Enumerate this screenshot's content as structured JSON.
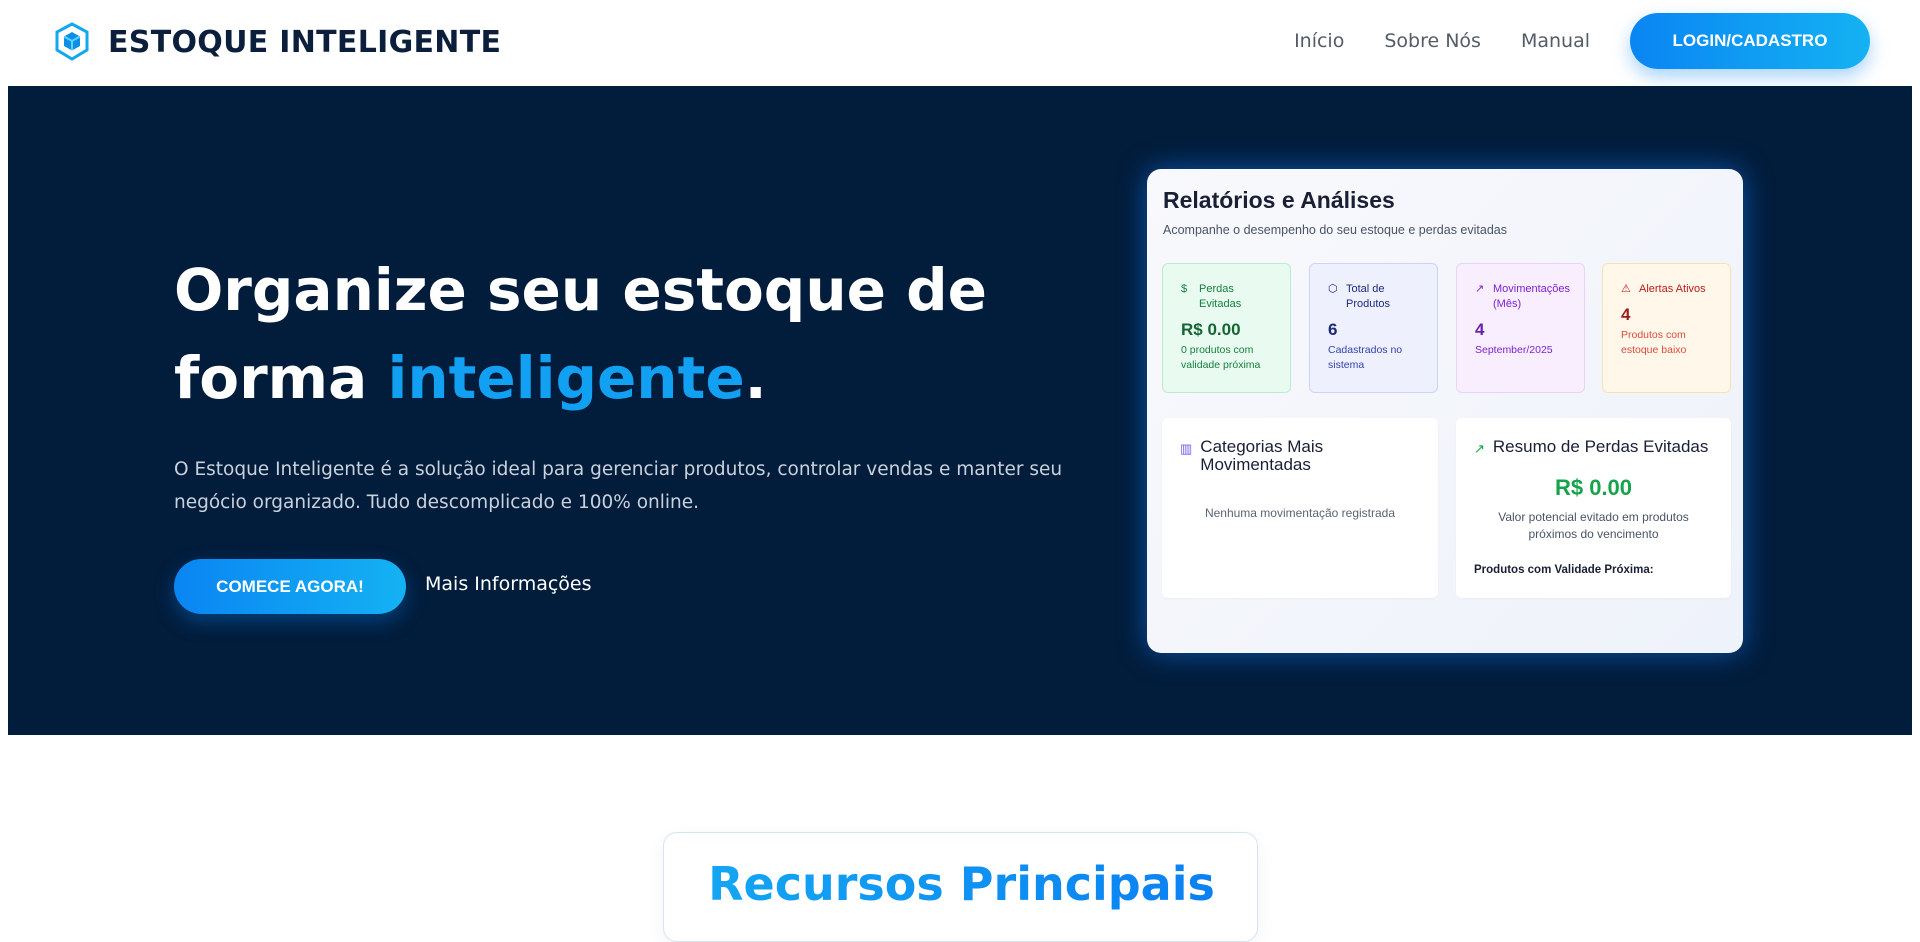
{
  "header": {
    "brand_name": "ESTOQUE INTELIGENTE",
    "logo_icon": "cube-logo-icon",
    "nav": [
      "Início",
      "Sobre Nós",
      "Manual"
    ],
    "login_label": "LOGIN/CADASTRO"
  },
  "hero": {
    "title_part1": "Organize seu estoque de forma ",
    "title_accent": "inteligente",
    "title_end": ".",
    "description": "O Estoque Inteligente é a solução ideal para gerenciar produtos, controlar vendas e manter seu negócio organizado. Tudo descomplicado e 100% online.",
    "cta_label": "COMECE AGORA!",
    "more_label": "Mais Informações"
  },
  "dashboard": {
    "title": "Relatórios e Análises",
    "subtitle": "Acompanhe o desempenho do seu estoque e perdas evitadas",
    "stats": [
      {
        "icon": "dollar-icon",
        "label": "Perdas Evitadas",
        "value": "R$ 0.00",
        "note": "0 produtos com validade próxima"
      },
      {
        "icon": "cube-icon",
        "label": "Total de Produtos",
        "value": "6",
        "note": "Cadastrados no sistema"
      },
      {
        "icon": "trend-icon",
        "label": "Movimentações (Mês)",
        "value": "4",
        "note": "September/2025"
      },
      {
        "icon": "warning-icon",
        "label": "Alertas Ativos",
        "value": "4",
        "note": "Produtos com estoque baixo"
      }
    ],
    "categories_panel": {
      "icon": "bar-chart-icon",
      "title": "Categorias Mais Movimentadas",
      "empty_text": "Nenhuma movimentação registrada"
    },
    "losses_panel": {
      "icon": "trend-up-icon",
      "title": "Resumo de Perdas Evitadas",
      "value": "R$ 0.00",
      "description": "Valor potencial evitado em produtos próximos do vencimento",
      "list_label": "Produtos com Validade Próxima:"
    }
  },
  "features": {
    "title": "Recursos Principais"
  },
  "colors": {
    "hero_bg": "#021c3b",
    "accent": "#12a0f3",
    "button": "#0a85f3"
  }
}
